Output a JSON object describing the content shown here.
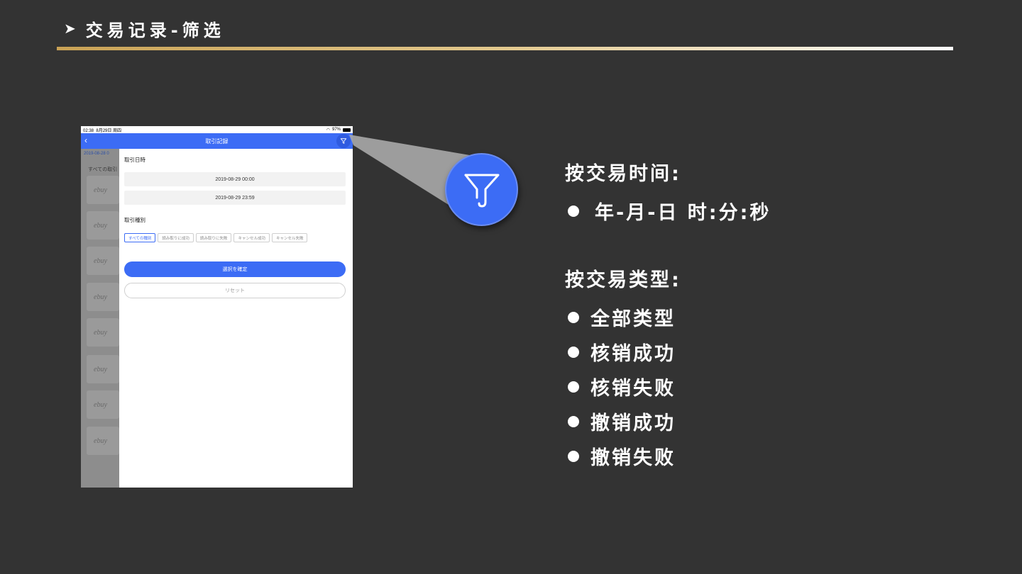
{
  "slide": {
    "title": "交易记录-筛选",
    "title_arrow": "➤"
  },
  "phone": {
    "status": {
      "time": "02:38",
      "date": "8月29日 周四",
      "battery": "97%"
    },
    "nav": {
      "back": "‹",
      "title": "取引記録"
    },
    "background": {
      "date_label": "2019-08-28 0",
      "all_label": "すべての取引",
      "card_logo": "ebuy"
    },
    "filter": {
      "datetime_label": "取引日時",
      "start": "2019-08-29 00:00",
      "end": "2019-08-29 23:59",
      "type_label": "取引種別",
      "types": [
        "すべての種別",
        "読み取りに成功",
        "読み取りに失敗",
        "キャンセル成功",
        "キャンセル失敗"
      ],
      "active_type_index": 0,
      "confirm_label": "選択を確定",
      "reset_label": "リセット"
    }
  },
  "info": {
    "time_heading": "按交易时间:",
    "time_format": "年-月-日 时:分:秒",
    "type_heading": "按交易类型:",
    "types": [
      "全部类型",
      "核销成功",
      "核销失败",
      "撤销成功",
      "撤销失败"
    ]
  },
  "colors": {
    "background": "#333333",
    "accent_blue": "#3c6cf5",
    "gold": "#c9a255"
  },
  "icons": {
    "zoom": "filter-icon"
  }
}
